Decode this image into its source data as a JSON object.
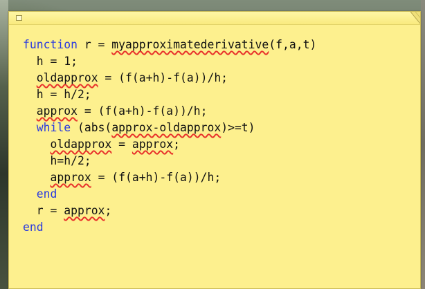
{
  "note": {
    "background_color": "#fdf08e",
    "keyword_color": "#2a3adf",
    "spellcheck_underline_color": "#e8322b",
    "close_icon": "close-box-icon",
    "collapse_icon": "collapse-corner-icon"
  },
  "code": {
    "lines": [
      [
        {
          "text": "function",
          "style": "kw"
        },
        {
          "text": " r = ",
          "style": "plain"
        },
        {
          "text": "myapproximatederivative",
          "style": "misspelled"
        },
        {
          "text": "(f,a,t)",
          "style": "plain"
        }
      ],
      [
        {
          "text": "  h = 1;",
          "style": "plain"
        }
      ],
      [
        {
          "text": "  ",
          "style": "plain"
        },
        {
          "text": "oldapprox",
          "style": "misspelled"
        },
        {
          "text": " = (f(a+h)-f(a))/h;",
          "style": "plain"
        }
      ],
      [
        {
          "text": "  h = h/2;",
          "style": "plain"
        }
      ],
      [
        {
          "text": "  ",
          "style": "plain"
        },
        {
          "text": "approx",
          "style": "misspelled"
        },
        {
          "text": " = (f(a+h)-f(a))/h;",
          "style": "plain"
        }
      ],
      [
        {
          "text": "  ",
          "style": "plain"
        },
        {
          "text": "while",
          "style": "kw"
        },
        {
          "text": " (abs(",
          "style": "plain"
        },
        {
          "text": "approx-oldapprox",
          "style": "misspelled"
        },
        {
          "text": ")>=t)",
          "style": "plain"
        }
      ],
      [
        {
          "text": "    ",
          "style": "plain"
        },
        {
          "text": "oldapprox",
          "style": "misspelled"
        },
        {
          "text": " = ",
          "style": "plain"
        },
        {
          "text": "approx",
          "style": "misspelled"
        },
        {
          "text": ";",
          "style": "plain"
        }
      ],
      [
        {
          "text": "    h=h/2;",
          "style": "plain"
        }
      ],
      [
        {
          "text": "    ",
          "style": "plain"
        },
        {
          "text": "approx",
          "style": "misspelled"
        },
        {
          "text": " = (f(a+h)-f(a))/h;",
          "style": "plain"
        }
      ],
      [
        {
          "text": "  ",
          "style": "plain"
        },
        {
          "text": "end",
          "style": "kw"
        }
      ],
      [
        {
          "text": "  r = ",
          "style": "plain"
        },
        {
          "text": "approx",
          "style": "misspelled"
        },
        {
          "text": ";",
          "style": "plain"
        }
      ],
      [
        {
          "text": "end",
          "style": "kw"
        }
      ]
    ]
  }
}
